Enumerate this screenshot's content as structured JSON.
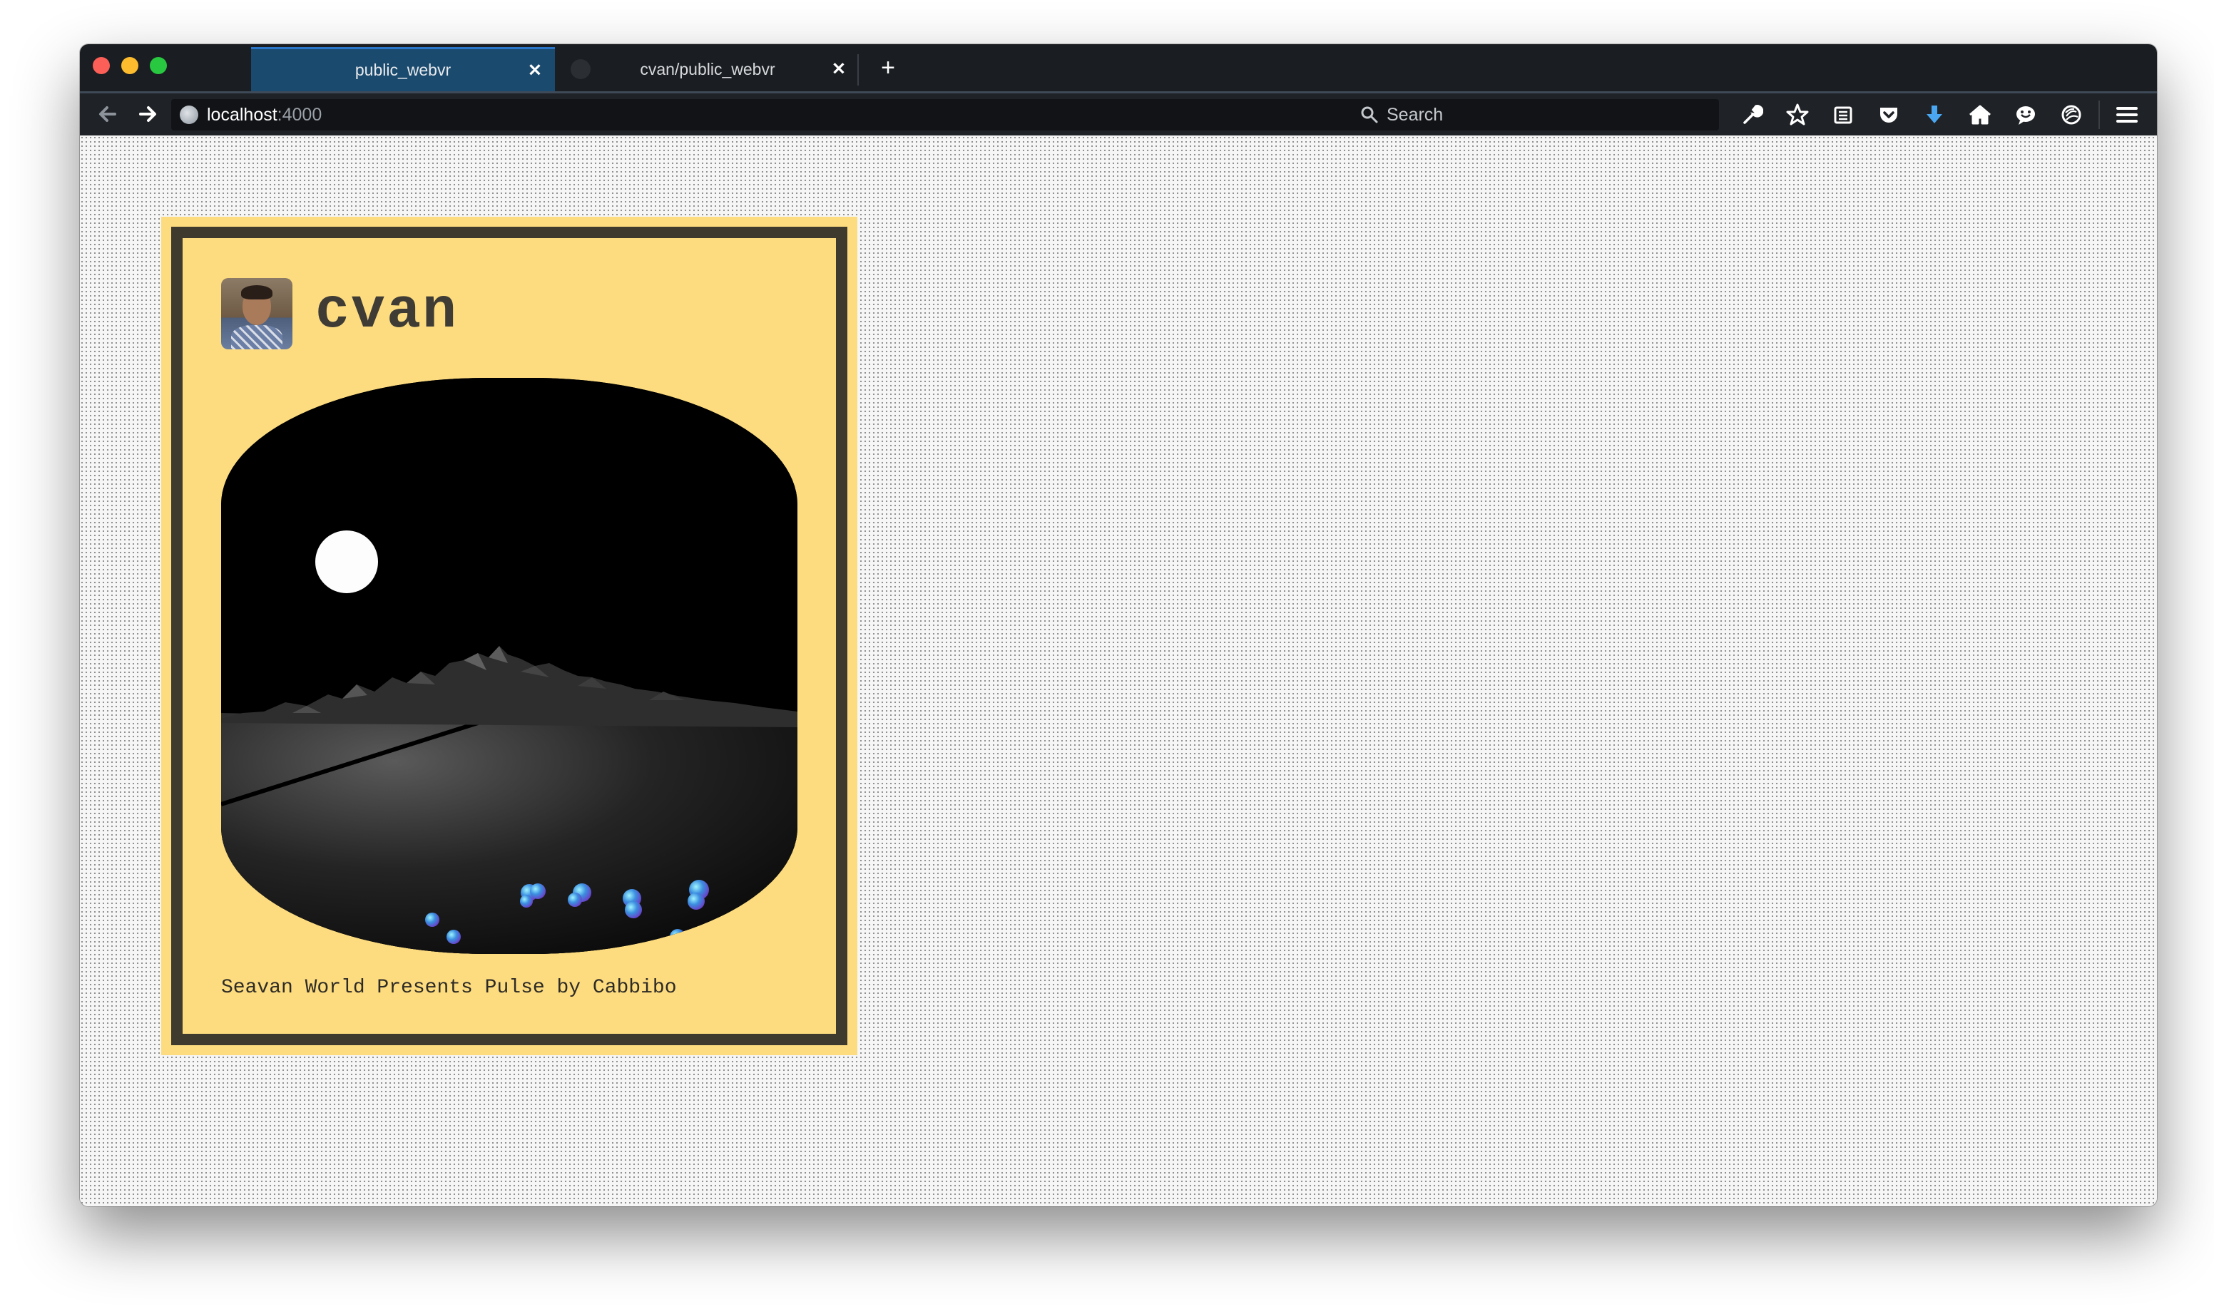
{
  "browser": {
    "tabs": [
      {
        "label": "public_webvr",
        "active": true
      },
      {
        "label": "cvan/public_webvr",
        "active": false
      }
    ],
    "new_tab_label": "+",
    "url": {
      "host": "localhost",
      "port": ":4000"
    },
    "search": {
      "placeholder": "Search"
    },
    "toolbar_icons": [
      "wrench-icon",
      "bookmark-star-icon",
      "reader-list-icon",
      "pocket-icon",
      "download-icon",
      "home-icon",
      "chat-icon",
      "tracking-icon",
      "menu-icon"
    ],
    "colors": {
      "chrome": "#1a1d21",
      "active_tab": "#1a4a6e",
      "download_accent": "#4aa6f0"
    }
  },
  "card": {
    "username": "cvan",
    "caption": "Seavan World Presents Pulse by Cabbibo",
    "background_color": "#fddc80",
    "border_color": "#3e3a2e"
  }
}
